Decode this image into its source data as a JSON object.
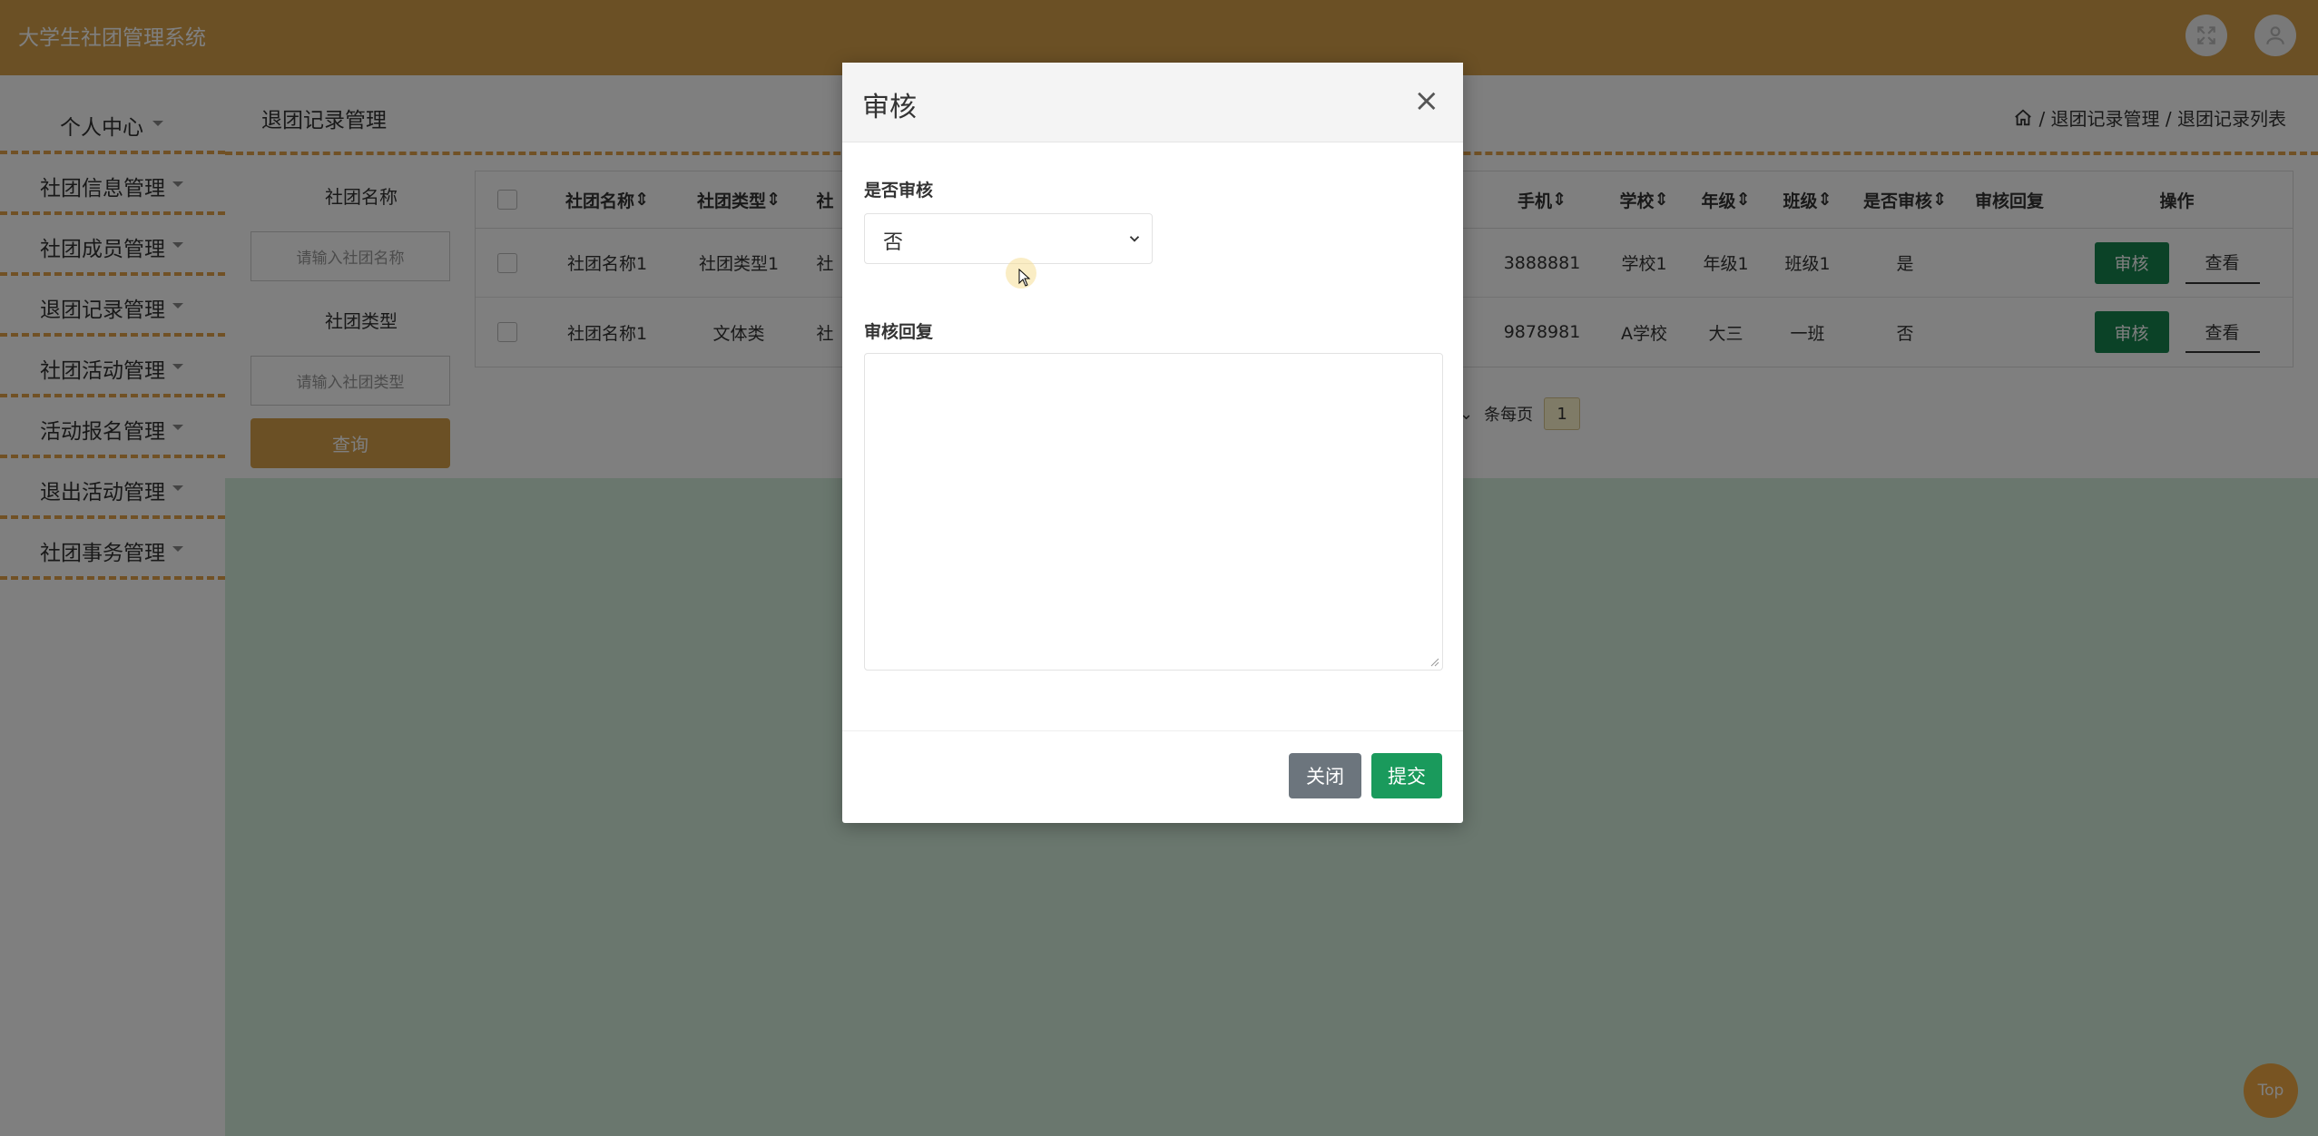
{
  "app": {
    "title": "大学生社团管理系统"
  },
  "sidebar": {
    "items": [
      {
        "label": "个人中心"
      },
      {
        "label": "社团信息管理"
      },
      {
        "label": "社团成员管理"
      },
      {
        "label": "退团记录管理"
      },
      {
        "label": "社团活动管理"
      },
      {
        "label": "活动报名管理"
      },
      {
        "label": "退出活动管理"
      },
      {
        "label": "社团事务管理"
      }
    ]
  },
  "page": {
    "section_title": "退团记录管理",
    "breadcrumb": "/ 退团记录管理 / 退团记录列表"
  },
  "filters": {
    "name_label": "社团名称",
    "name_placeholder": "请输入社团名称",
    "type_label": "社团类型",
    "type_placeholder": "请输入社团类型",
    "query_button": "查询"
  },
  "table": {
    "headers": [
      "社团名称",
      "社团类型",
      "社",
      "手机",
      "学校",
      "年级",
      "班级",
      "是否审核",
      "审核回复",
      "操作"
    ],
    "rows": [
      {
        "name": "社团名称1",
        "type": "社团类型1",
        "col3": "社",
        "phone": "3888881",
        "school": "学校1",
        "grade": "年级1",
        "cls": "班级1",
        "audited": "是",
        "reply": ""
      },
      {
        "name": "社团名称1",
        "type": "文体类",
        "col3": "社",
        "phone": "9878981",
        "school": "A学校",
        "grade": "大三",
        "cls": "一班",
        "audited": "否",
        "reply": ""
      }
    ],
    "audit_button": "审核",
    "view_button": "查看"
  },
  "pager": {
    "per_page_label": "条每页",
    "current_page": "1"
  },
  "back_to_top": "Top",
  "modal": {
    "title": "审核",
    "close_glyph": "×",
    "audit_label": "是否审核",
    "audit_value": "否",
    "reply_label": "审核回复",
    "reply_value": "",
    "close_button": "关闭",
    "submit_button": "提交"
  },
  "colors": {
    "brand": "#d6a04b",
    "audit_green": "#17844f",
    "submit_green": "#1a9a5c",
    "close_gray": "#6c757d"
  }
}
